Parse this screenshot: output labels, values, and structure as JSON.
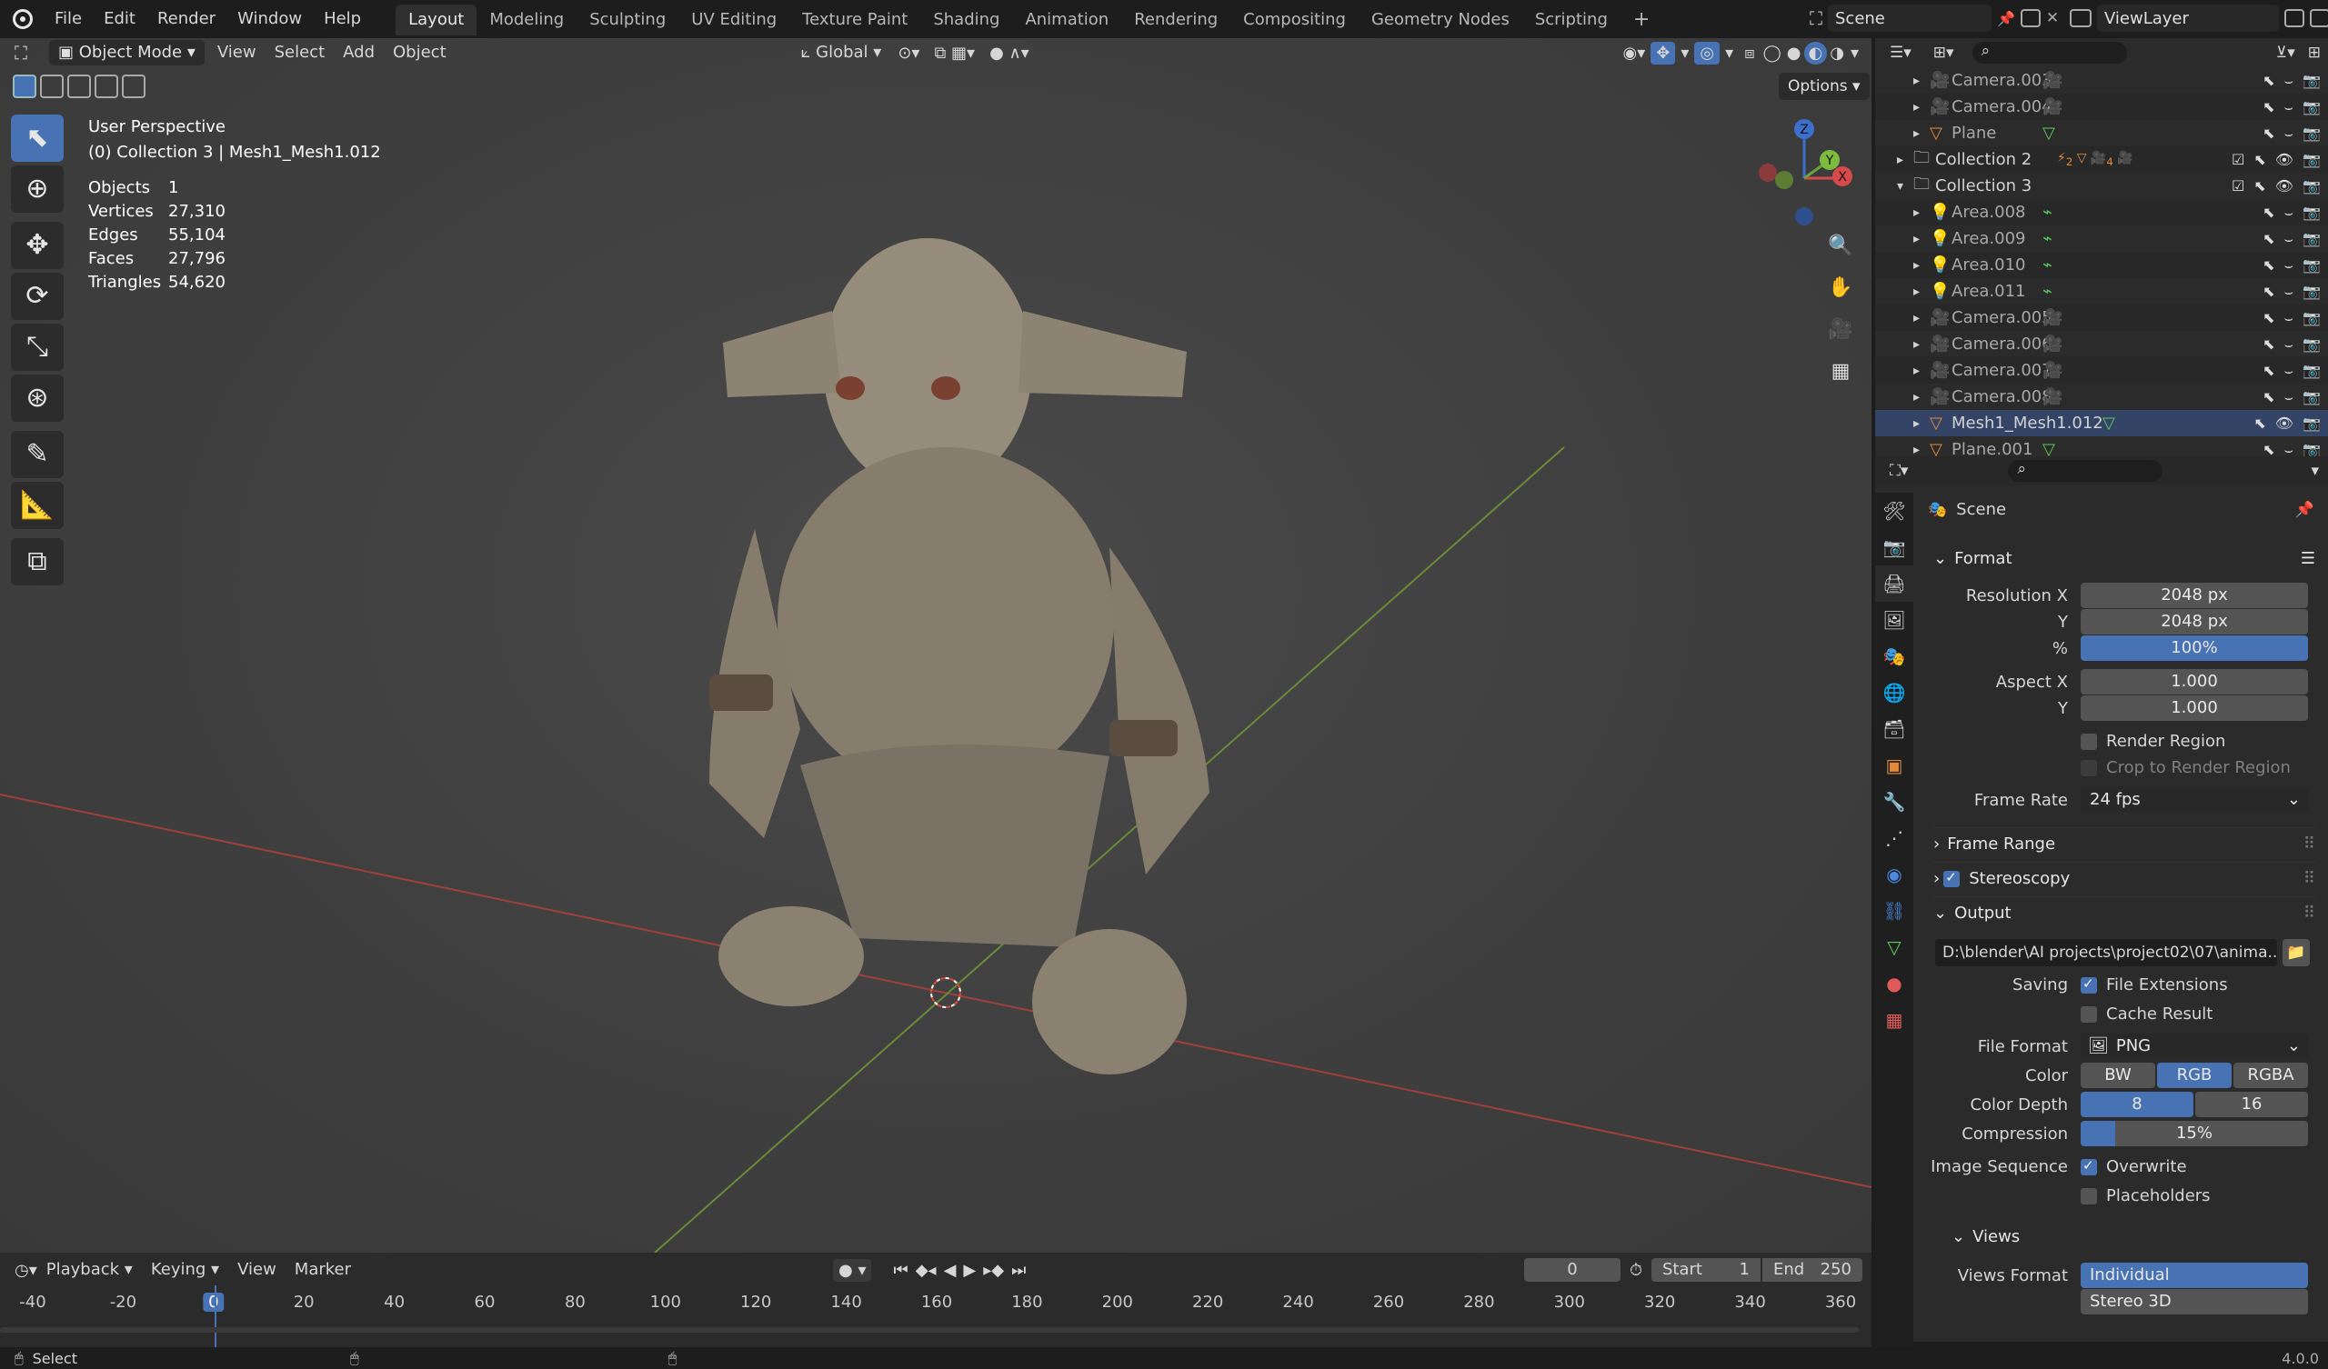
{
  "topbar": {
    "menus": [
      "File",
      "Edit",
      "Render",
      "Window",
      "Help"
    ],
    "workspaces": [
      "Layout",
      "Modeling",
      "Sculpting",
      "UV Editing",
      "Texture Paint",
      "Shading",
      "Animation",
      "Rendering",
      "Compositing",
      "Geometry Nodes",
      "Scripting"
    ],
    "active_workspace": "Layout",
    "add_tab": "+",
    "scene_name": "Scene",
    "view_layer": "ViewLayer"
  },
  "viewport_header": {
    "mode": "Object Mode",
    "menus": [
      "View",
      "Select",
      "Add",
      "Object"
    ],
    "transform_orientation": "Global",
    "options": "Options"
  },
  "overlay": {
    "perspective": "User Perspective",
    "collection": "(0) Collection 3 | Mesh1_Mesh1.012",
    "stats": [
      {
        "label": "Objects",
        "value": "1"
      },
      {
        "label": "Vertices",
        "value": "27,310"
      },
      {
        "label": "Edges",
        "value": "55,104"
      },
      {
        "label": "Faces",
        "value": "27,796"
      },
      {
        "label": "Triangles",
        "value": "54,620"
      }
    ],
    "gizmo": {
      "z": "Z",
      "y": "Y",
      "x": "X"
    }
  },
  "outliner": {
    "rows": [
      {
        "name": "Camera.003",
        "type": "camera",
        "indent": 2
      },
      {
        "name": "Camera.004",
        "type": "camera",
        "indent": 2
      },
      {
        "name": "Plane",
        "type": "mesh",
        "indent": 2
      },
      {
        "name": "Collection 2",
        "type": "collection",
        "indent": 1,
        "expanded": false,
        "badge2": "2",
        "badge4": "4"
      },
      {
        "name": "Collection 3",
        "type": "collection",
        "indent": 1,
        "expanded": true
      },
      {
        "name": "Area.008",
        "type": "light",
        "indent": 2
      },
      {
        "name": "Area.009",
        "type": "light",
        "indent": 2
      },
      {
        "name": "Area.010",
        "type": "light",
        "indent": 2
      },
      {
        "name": "Area.011",
        "type": "light",
        "indent": 2
      },
      {
        "name": "Camera.005",
        "type": "camera",
        "indent": 2
      },
      {
        "name": "Camera.006",
        "type": "camera",
        "indent": 2
      },
      {
        "name": "Camera.007",
        "type": "camera",
        "indent": 2
      },
      {
        "name": "Camera.008",
        "type": "camera",
        "indent": 2
      },
      {
        "name": "Mesh1_Mesh1.012",
        "type": "mesh",
        "indent": 2,
        "active": true
      },
      {
        "name": "Plane.001",
        "type": "mesh",
        "indent": 2
      }
    ]
  },
  "properties": {
    "context": "Scene",
    "format": {
      "title": "Format",
      "resolution_x_label": "Resolution X",
      "resolution_x": "2048 px",
      "y_label": "Y",
      "resolution_y": "2048 px",
      "pct_label": "%",
      "resolution_pct": "100%",
      "aspect_x_label": "Aspect X",
      "aspect_x": "1.000",
      "aspect_y": "1.000",
      "render_region": "Render Region",
      "crop_region": "Crop to Render Region",
      "frame_rate_label": "Frame Rate",
      "frame_rate": "24 fps"
    },
    "frame_range": "Frame Range",
    "stereoscopy": "Stereoscopy",
    "output": {
      "title": "Output",
      "path": "D:\\blender\\AI projects\\project02\\07\\anima...",
      "saving_label": "Saving",
      "file_extensions": "File Extensions",
      "cache_result": "Cache Result",
      "file_format_label": "File Format",
      "file_format": "PNG",
      "color_label": "Color",
      "color_options": [
        "BW",
        "RGB",
        "RGBA"
      ],
      "color_selected": "RGB",
      "color_depth_label": "Color Depth",
      "color_depth_options": [
        "8",
        "16"
      ],
      "color_depth_selected": "8",
      "compression_label": "Compression",
      "compression": "15%",
      "compression_value": 0.15,
      "image_sequence_label": "Image Sequence",
      "overwrite": "Overwrite",
      "placeholders": "Placeholders"
    },
    "views": {
      "title": "Views",
      "views_format_label": "Views Format",
      "options": [
        "Individual",
        "Stereo 3D"
      ],
      "selected": "Individual"
    }
  },
  "timeline": {
    "menus": [
      "Playback",
      "Keying",
      "View",
      "Marker"
    ],
    "current_frame": "0",
    "start_label": "Start",
    "start": "1",
    "end_label": "End",
    "end": "250",
    "ruler": [
      "-40",
      "-20",
      "0",
      "20",
      "40",
      "60",
      "80",
      "100",
      "120",
      "140",
      "160",
      "180",
      "200",
      "220",
      "240",
      "260",
      "280",
      "300",
      "320",
      "340",
      "360"
    ]
  },
  "statusbar": {
    "select": "Select",
    "version": "4.0.0"
  }
}
